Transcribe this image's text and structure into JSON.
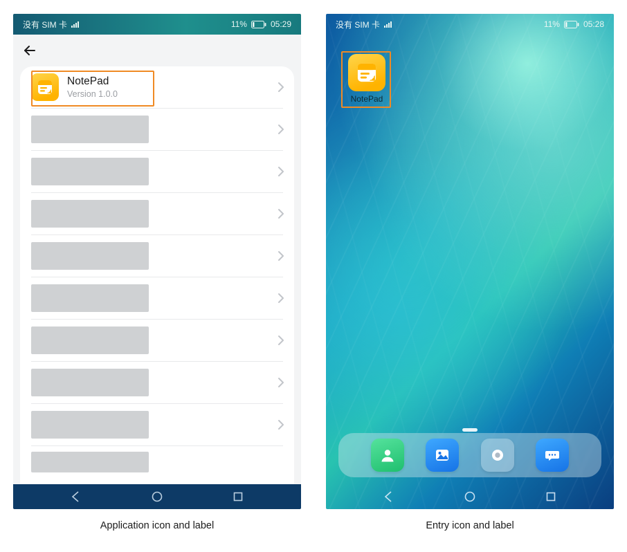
{
  "status": {
    "carrier": "没有 SIM 卡",
    "battery_pct": "11%",
    "time_left": "05:29",
    "time_right": "05:28"
  },
  "app_row": {
    "name": "NotePad",
    "version": "Version 1.0.0"
  },
  "home": {
    "icon_label": "NotePad"
  },
  "dock": {
    "items": [
      "contacts",
      "gallery",
      "camera",
      "messages"
    ]
  },
  "captions": {
    "left": "Application icon and label",
    "right": "Entry icon and label"
  }
}
